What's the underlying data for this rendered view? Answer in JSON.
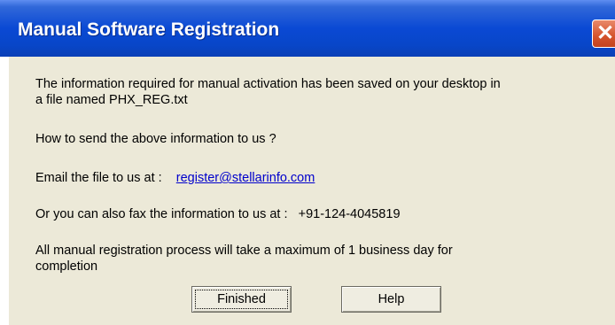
{
  "window": {
    "title": "Manual Software Registration",
    "close_glyph": "✕"
  },
  "body": {
    "line1": "The information required for manual activation has been saved on your desktop in",
    "line2": "a file named PHX_REG.txt",
    "how_to_send": "How to send the above information to us ?",
    "email_label": "Email the file  to us at :",
    "email_address": "register@stellarinfo.com",
    "fax_label": "Or you can also fax the information  to us at :",
    "fax_number": "+91-124-4045819",
    "note_line1": "All manual registration process will take a maximum of 1 business day for",
    "note_line2": "completion"
  },
  "buttons": {
    "finished_label": "Finished",
    "help_label": "Help"
  },
  "colors": {
    "titlebar": "#0a49d4",
    "close_button": "#d4532c",
    "client_background": "#ece9d8",
    "link": "#0000cc"
  }
}
